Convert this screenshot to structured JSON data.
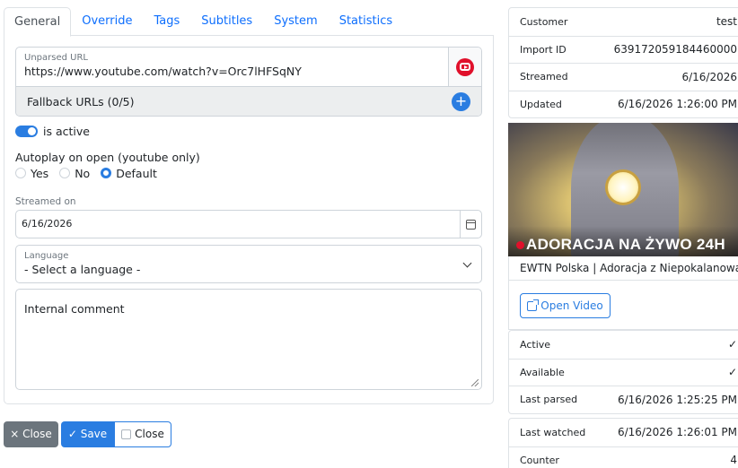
{
  "tabs": [
    "General",
    "Override",
    "Tags",
    "Subtitles",
    "System",
    "Statistics"
  ],
  "url": {
    "label": "Unparsed URL",
    "value": "https://www.youtube.com/watch?v=Orc7lHFSqNY",
    "youtube_icon": "youtube-icon"
  },
  "fallback": {
    "label": "Fallback URLs (0/5)",
    "add_icon": "plus-icon"
  },
  "active": {
    "label": "is active",
    "on": true
  },
  "autoplay": {
    "label": "Autoplay on open (youtube only)",
    "options": [
      "Yes",
      "No",
      "Default"
    ],
    "selected": "Default"
  },
  "streamed": {
    "label": "Streamed on",
    "value": "6/16/2026"
  },
  "language": {
    "label": "Language",
    "value": "- Select a language -"
  },
  "comment": {
    "placeholder": "Internal comment"
  },
  "buttons": {
    "close_dark": "× Close",
    "save": "✓ Save",
    "close_outline": "Close"
  },
  "info_top": [
    {
      "key": "Customer",
      "value": "test"
    },
    {
      "key": "Import ID",
      "value": "639172059184460000"
    },
    {
      "key": "Streamed",
      "value": "6/16/2026"
    },
    {
      "key": "Updated",
      "value": "6/16/2026 1:26:00 PM"
    }
  ],
  "thumbnail": {
    "overlay_text": "ADORACJA NA ŻYWO 24H"
  },
  "video": {
    "title": "EWTN Polska | Adoracja z Niepokalanowa",
    "open_label": "Open Video"
  },
  "status_rows": [
    {
      "key": "Active",
      "value": "✓"
    },
    {
      "key": "Available",
      "value": "✓"
    },
    {
      "key": "Last parsed",
      "value": "6/16/2026 1:25:25 PM"
    }
  ],
  "watch_rows": [
    {
      "key": "Last watched",
      "value": "6/16/2026 1:26:01 PM"
    },
    {
      "key": "Counter",
      "value": "4"
    }
  ],
  "colors": {
    "primary": "#2a7de1",
    "secondary": "#6c757d",
    "youtube": "#e0102b"
  }
}
